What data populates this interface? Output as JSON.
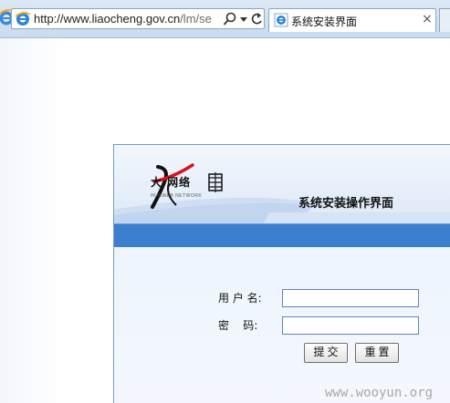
{
  "browser": {
    "address_url_main": "http://www.liaocheng.gov.cn",
    "address_url_path": "/lm/se",
    "tab_title": "系统安装界面",
    "tab_close": "×"
  },
  "page": {
    "logo_text": "大  网络",
    "logo_sub": "HUNWEB NETWORK",
    "panel_title": "系统安装操作界面",
    "username_label": "用 户 名:",
    "password_label": "密    码:",
    "username_value": "",
    "password_value": "",
    "submit_label": "提交",
    "reset_label": "重置"
  },
  "watermark": "www.wooyun.org",
  "colors": {
    "header_bar": "#3d7fcf",
    "panel_border": "#7a9cc6",
    "logo_red": "#d8121a"
  },
  "icons": [
    "ie-logo-icon",
    "ie-page-icon",
    "search-icon",
    "dropdown-icon",
    "refresh-icon",
    "close-icon"
  ]
}
